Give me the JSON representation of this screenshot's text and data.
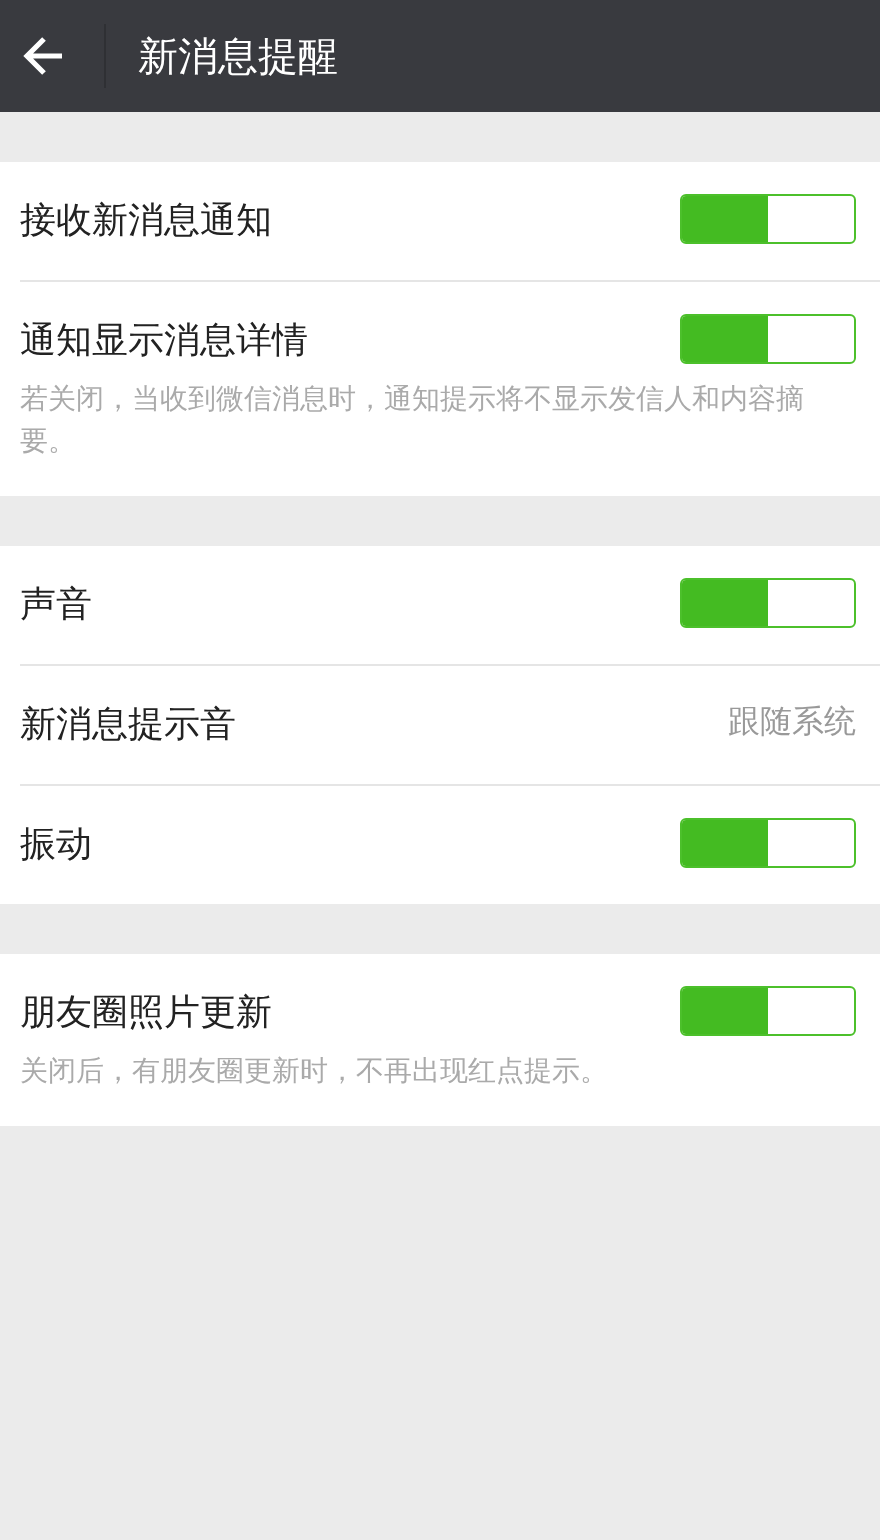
{
  "header": {
    "title": "新消息提醒"
  },
  "sections": [
    {
      "items": [
        {
          "kind": "switch",
          "label": "接收新消息通知",
          "on": true
        },
        {
          "kind": "switch",
          "label": "通知显示消息详情",
          "on": true,
          "note": "若关闭，当收到微信消息时，通知提示将不显示发信人和内容摘要。"
        }
      ]
    },
    {
      "items": [
        {
          "kind": "switch",
          "label": "声音",
          "on": true
        },
        {
          "kind": "value",
          "label": "新消息提示音",
          "value": "跟随系统"
        },
        {
          "kind": "switch",
          "label": "振动",
          "on": true
        }
      ]
    },
    {
      "items": [
        {
          "kind": "switch",
          "label": "朋友圈照片更新",
          "on": true,
          "note": "关闭后，有朋友圈更新时，不再出现红点提示。"
        }
      ]
    }
  ]
}
